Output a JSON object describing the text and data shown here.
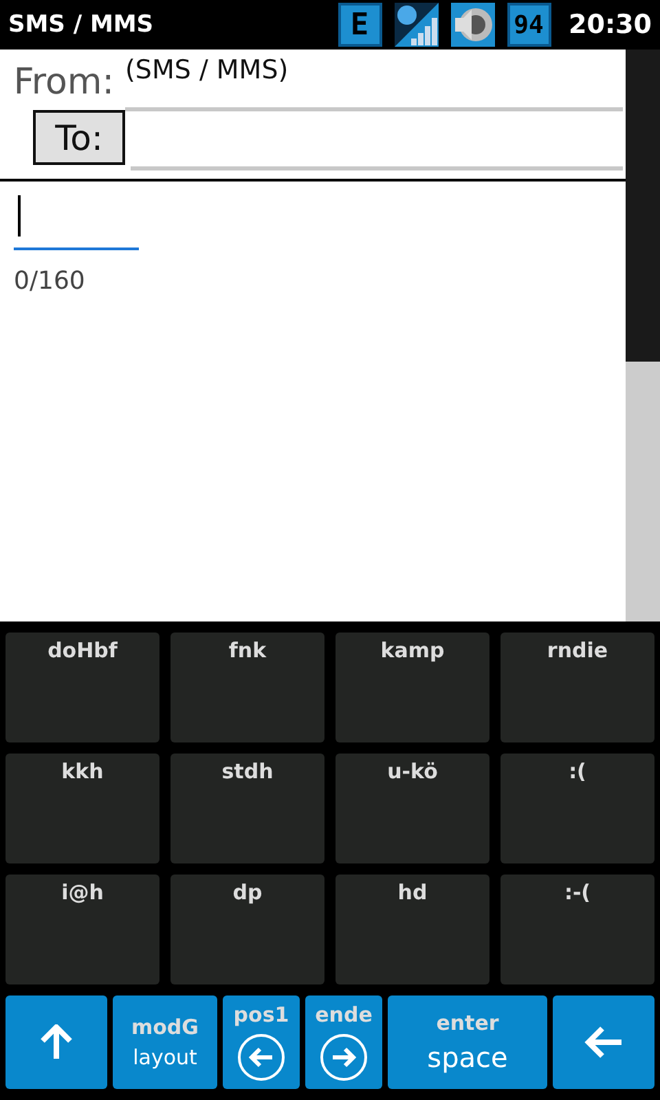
{
  "status_bar": {
    "title": "SMS / MMS",
    "network": "E",
    "battery": "94",
    "time": "20:30"
  },
  "header": {
    "from_label": "From:",
    "from_value": "(SMS / MMS)",
    "to_button": "To:"
  },
  "message": {
    "counter": "0/160"
  },
  "keyboard": {
    "rows": [
      [
        "doHbf",
        "fnk",
        "kamp",
        "rndie"
      ],
      [
        "kkh",
        "stdh",
        "u-kö",
        ":("
      ],
      [
        "i@h",
        "dp",
        "hd",
        ":-("
      ]
    ],
    "bottom_keys": [
      {
        "kind": "shift"
      },
      {
        "kind": "dual",
        "top": "modG",
        "bottom": "layout"
      },
      {
        "kind": "left",
        "top": "pos1"
      },
      {
        "kind": "right",
        "top": "ende"
      },
      {
        "kind": "space",
        "top": "enter",
        "bottom": "space"
      },
      {
        "kind": "backspace"
      }
    ]
  }
}
